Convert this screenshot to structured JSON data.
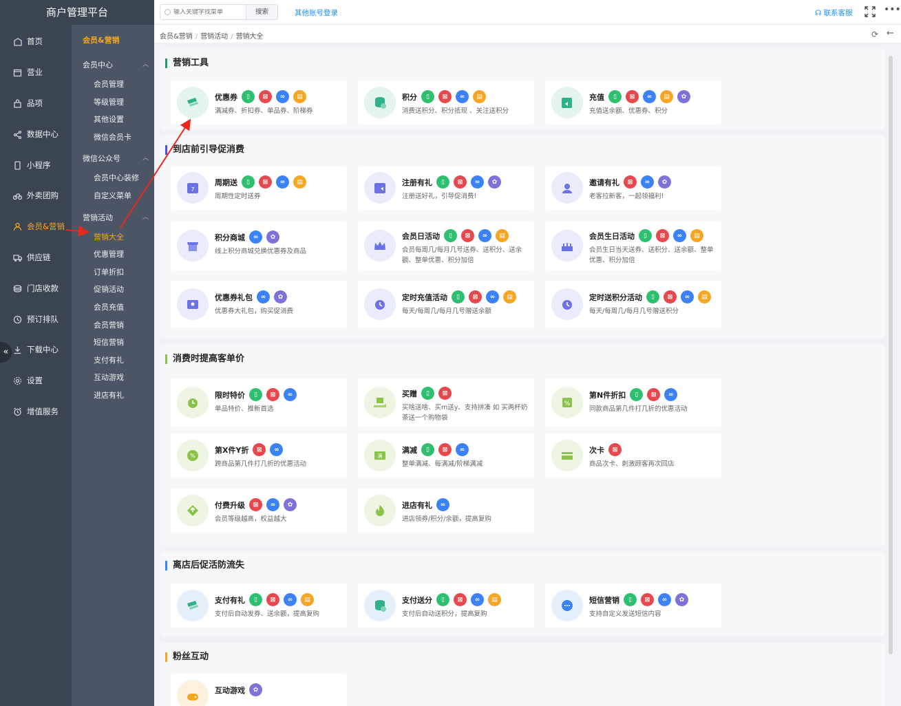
{
  "app": {
    "title": "商户管理平台"
  },
  "nav1": [
    {
      "label": "首页",
      "icon": "home-icon"
    },
    {
      "label": "营业",
      "icon": "calendar-icon"
    },
    {
      "label": "品项",
      "icon": "bag-icon"
    },
    {
      "label": "数据中心",
      "icon": "share-icon"
    },
    {
      "label": "小程序",
      "icon": "phone-icon"
    },
    {
      "label": "外卖团购",
      "icon": "bike-icon"
    },
    {
      "label": "会员&营销",
      "icon": "user-icon"
    },
    {
      "label": "供应链",
      "icon": "truck-icon"
    },
    {
      "label": "门店收款",
      "icon": "coins-icon"
    },
    {
      "label": "预订排队",
      "icon": "clock-icon"
    },
    {
      "label": "下载中心",
      "icon": "download-icon"
    },
    {
      "label": "设置",
      "icon": "gear-icon"
    },
    {
      "label": "增值服务",
      "icon": "alarm-icon"
    }
  ],
  "nav2": {
    "title": "会员&营销",
    "groups": [
      {
        "label": "会员中心",
        "items": [
          "会员管理",
          "等级管理",
          "其他设置",
          "微信会员卡"
        ]
      },
      {
        "label": "微信公众号",
        "items": [
          "会员中心装修",
          "自定义菜单"
        ]
      },
      {
        "label": "营销活动",
        "items": [
          "营销大全",
          "优惠管理",
          "订单折扣",
          "促销活动",
          "会员充值",
          "会员营销",
          "短信营销",
          "支付有礼",
          "互动游戏",
          "进店有礼"
        ]
      }
    ]
  },
  "topbar": {
    "search_placeholder": "输入关键字找菜单",
    "search_btn": "搜索",
    "other_login": "其他账号登录",
    "contact": "联系客服",
    "more": "•••"
  },
  "breadcrumb": [
    "会员&营销",
    "营销活动",
    "营销大全"
  ],
  "badges": {
    "b1": "▯",
    "b2": "⊠",
    "b3": "∞",
    "b4": "▤",
    "b5": "✿"
  },
  "colors": {
    "primary": "#1a9b6c",
    "accent": "#f5a623",
    "link": "#1890ff"
  },
  "sections": [
    {
      "title": "营销工具",
      "cards": [
        {
          "name": "优惠券",
          "desc": "满减券、折扣券、单品券、阶梯券",
          "badges": [
            "b1",
            "b2",
            "b3",
            "b4"
          ],
          "icon": "ticket-icon"
        },
        {
          "name": "积分",
          "desc": "消费送积分、积分抵现 、关注送积分",
          "badges": [
            "b1",
            "b2",
            "b3",
            "b4"
          ],
          "icon": "coins-stack-icon"
        },
        {
          "name": "充值",
          "desc": "充值送余额、优惠券、积分",
          "badges": [
            "b1",
            "b2",
            "b3",
            "b4",
            "b5"
          ],
          "icon": "wallet-icon"
        }
      ]
    },
    {
      "title": "到店前引导促消费",
      "cards": [
        {
          "name": "周期送",
          "desc": "周期性定时送券",
          "badges": [
            "b1",
            "b2",
            "b3",
            "b4"
          ],
          "icon": "calendar-7-icon"
        },
        {
          "name": "注册有礼",
          "desc": "注册送好礼，引导促消费!",
          "badges": [
            "b1",
            "b2",
            "b3",
            "b5"
          ],
          "icon": "register-gift-icon"
        },
        {
          "name": "邀请有礼",
          "desc": "老客拉新客，一起领福利!",
          "badges": [
            "b2",
            "b3",
            "b5"
          ],
          "icon": "invite-icon"
        },
        {
          "name": "积分商城",
          "desc": "线上积分商城兑换优惠券及商品",
          "badges": [
            "b3",
            "b5"
          ],
          "icon": "shop-icon"
        },
        {
          "name": "会员日活动",
          "desc": "会员每周几/每月几号送券、送积分、送余额、整单优惠、积分加倍",
          "badges": [
            "b1",
            "b2",
            "b3",
            "b4"
          ],
          "icon": "crown-icon"
        },
        {
          "name": "会员生日活动",
          "desc": "会员生日当天送券、送积分、送余额、整单优惠、积分加倍",
          "badges": [
            "b1",
            "b2",
            "b3",
            "b4"
          ],
          "icon": "cake-icon"
        },
        {
          "name": "优惠券礼包",
          "desc": "优惠券大礼包，购买促消费",
          "badges": [
            "b3",
            "b5"
          ],
          "icon": "coupon-pack-icon"
        },
        {
          "name": "定时充值活动",
          "desc": "每天/每周几/每月几号赠送余额",
          "badges": [
            "b1",
            "b2",
            "b3",
            "b4"
          ],
          "icon": "alarm-clock-icon"
        },
        {
          "name": "定时送积分活动",
          "desc": "每天/每周几/每月几号赠送积分",
          "badges": [
            "b1",
            "b2",
            "b3",
            "b4"
          ],
          "icon": "alarm-clock-icon"
        }
      ]
    },
    {
      "title": "消费时提高客单价",
      "cards": [
        {
          "name": "限时特价",
          "desc": "单品特价、推新首选",
          "badges": [
            "b1",
            "b2",
            "b3"
          ],
          "icon": "timer-icon"
        },
        {
          "name": "买赠",
          "desc": "买啥送啥、买m送y、支持拼凑 如 买两杯奶茶送一个购物袋",
          "badges": [
            "b1",
            "b2"
          ],
          "icon": "gift-hand-icon"
        },
        {
          "name": "第N件折扣",
          "desc": "同款商品第几件打几折的优惠活动",
          "badges": [
            "b1",
            "b2",
            "b3"
          ],
          "icon": "percent-icon"
        },
        {
          "name": "第X件Y折",
          "desc": "跨商品第几件打几折的优惠活动",
          "badges": [
            "b2",
            "b3"
          ],
          "icon": "discount-icon"
        },
        {
          "name": "满减",
          "desc": "整单满减、每满减/阶梯满减",
          "badges": [
            "b1",
            "b2",
            "b3"
          ],
          "icon": "full-reduce-icon"
        },
        {
          "name": "次卡",
          "desc": "商品次卡、刺激顾客再次回店",
          "badges": [
            "b2"
          ],
          "icon": "card-icon"
        },
        {
          "name": "付费升级",
          "desc": "会员等级越高，权益越大",
          "badges": [
            "b2",
            "b3",
            "b5"
          ],
          "icon": "diamond-icon"
        },
        {
          "name": "进店有礼",
          "desc": "进店领券/积分/余额，提高复购",
          "badges": [
            "b3"
          ],
          "icon": "flame-icon"
        }
      ]
    },
    {
      "title": "离店后促活防流失",
      "cards": [
        {
          "name": "支付有礼",
          "desc": "支付后自动发券、送余额，提高复购",
          "badges": [
            "b1",
            "b2",
            "b3",
            "b4"
          ],
          "icon": "ticket-icon"
        },
        {
          "name": "支付送分",
          "desc": "支付后自动送积分，提高复购",
          "badges": [
            "b1",
            "b2",
            "b3",
            "b4"
          ],
          "icon": "coins-stack-icon"
        },
        {
          "name": "短信营销",
          "desc": "支持自定义发送短信内容",
          "badges": [
            "b1",
            "b2",
            "b3",
            "b5"
          ],
          "icon": "chat-icon"
        }
      ]
    },
    {
      "title": "粉丝互动",
      "cards": [
        {
          "name": "互动游戏",
          "desc": "",
          "badges": [
            "b5"
          ],
          "icon": "game-icon"
        }
      ]
    }
  ]
}
